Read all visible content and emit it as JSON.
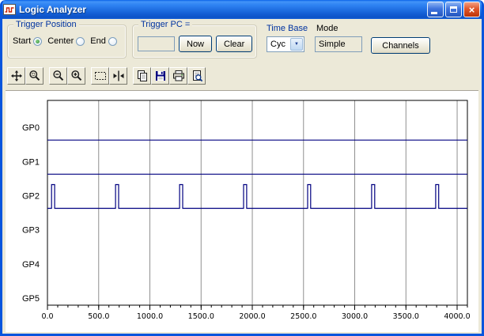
{
  "window": {
    "title": "Logic Analyzer"
  },
  "controls": {
    "trigger_position": {
      "label": "Trigger Position",
      "options": [
        {
          "label": "Start",
          "selected": true
        },
        {
          "label": "Center",
          "selected": false
        },
        {
          "label": "End",
          "selected": false
        }
      ]
    },
    "trigger_pc": {
      "label": "Trigger PC =",
      "value": "",
      "now_button": "Now",
      "clear_button": "Clear"
    },
    "time_base": {
      "label": "Time Base",
      "value": "Cyc"
    },
    "mode": {
      "label": "Mode",
      "value": "Simple"
    },
    "channels_button": "Channels"
  },
  "toolbar": {
    "buttons": [
      "pan",
      "zoom-window",
      "zoom-out",
      "zoom-in",
      "select-region",
      "markers",
      "copy",
      "save",
      "print",
      "print-preview"
    ]
  },
  "chart_data": {
    "type": "line",
    "title": "",
    "channels": [
      "GP0",
      "GP1",
      "GP2",
      "GP3",
      "GP4",
      "GP5"
    ],
    "x_ticks": [
      0,
      500,
      1000,
      1500,
      2000,
      2500,
      3000,
      3500,
      4000
    ],
    "x_tick_labels": [
      "0.0",
      "500.0",
      "1000.0",
      "1500.0",
      "2000.0",
      "2500.0",
      "3000.0",
      "3500.0",
      "4000.0"
    ],
    "xlim": [
      0,
      4100
    ],
    "minor_tick_step": 100,
    "grid": true,
    "legend": "none",
    "signals": [
      {
        "channel": "GP0",
        "baseline": "low",
        "pulses": []
      },
      {
        "channel": "GP1",
        "baseline": "low",
        "pulses": []
      },
      {
        "channel": "GP2",
        "baseline": "low",
        "pulses": [
          40,
          665,
          1290,
          1915,
          2540,
          3165,
          3790
        ],
        "pulse_width": 30
      },
      {
        "channel": "GP3",
        "baseline": "none",
        "pulses": []
      },
      {
        "channel": "GP4",
        "baseline": "none",
        "pulses": []
      },
      {
        "channel": "GP5",
        "baseline": "none",
        "pulses": []
      }
    ],
    "colors": {
      "signal": "#000080",
      "grid": "#8F8F8F",
      "frame": "#000000"
    }
  },
  "theme": {
    "titlebar_blue": "#1460D6",
    "caption_text": "#0033A0",
    "window_bg": "#ECE9D8"
  }
}
